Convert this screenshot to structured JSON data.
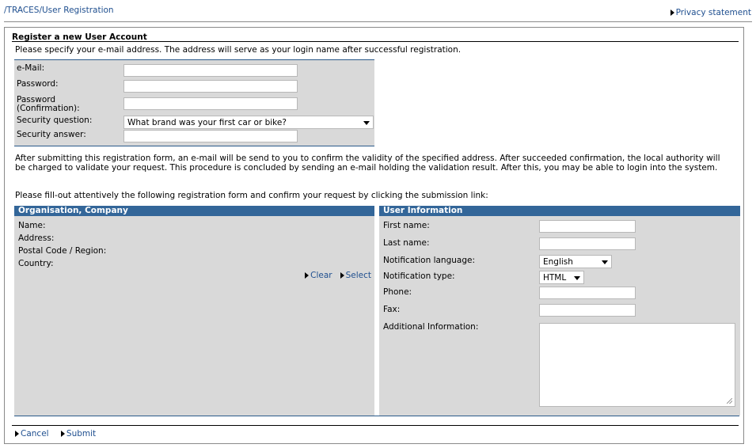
{
  "breadcrumb": {
    "root": "/TRACES/",
    "current": "User Registration"
  },
  "privacy_link": "Privacy statement",
  "form_title": "Register a new User Account",
  "intro": "Please specify your e-mail address. The address will serve as your login name after successful registration.",
  "account": {
    "email_label": "e-Mail:",
    "password_label": "Password:",
    "confirm_label_1": "Password",
    "confirm_label_2": "(Confirmation):",
    "question_label": "Security question:",
    "question_value": "What brand was your first car or bike?",
    "answer_label": "Security answer:"
  },
  "info_text": "After submitting this registration form, an e-mail will be send to you to confirm the validity of the specified address. After succeeded confirmation, the local authority will be charged to validate your request. This procedure is concluded by sending an e-mail holding the validation result. After this, you may be able to login into the system.",
  "fill_text": "Please fill-out attentively the following registration form and confirm your request by clicking the submission link:",
  "org": {
    "title": "Organisation, Company",
    "name_label": "Name:",
    "address_label": "Address:",
    "postal_label": "Postal Code / Region:",
    "country_label": "Country:",
    "clear_link": "Clear",
    "select_link": "Select"
  },
  "user": {
    "title": "User Information",
    "first_name_label": "First name:",
    "last_name_label": "Last name:",
    "lang_label": "Notification language:",
    "lang_value": "English",
    "type_label": "Notification type:",
    "type_value": "HTML",
    "phone_label": "Phone:",
    "fax_label": "Fax:",
    "additional_label": "Additional Information:"
  },
  "footer": {
    "cancel": "Cancel",
    "submit": "Submit"
  },
  "colors": {
    "panel_header": "#336699",
    "panel_bg": "#d9d9d9",
    "link": "#1f4f8f"
  }
}
